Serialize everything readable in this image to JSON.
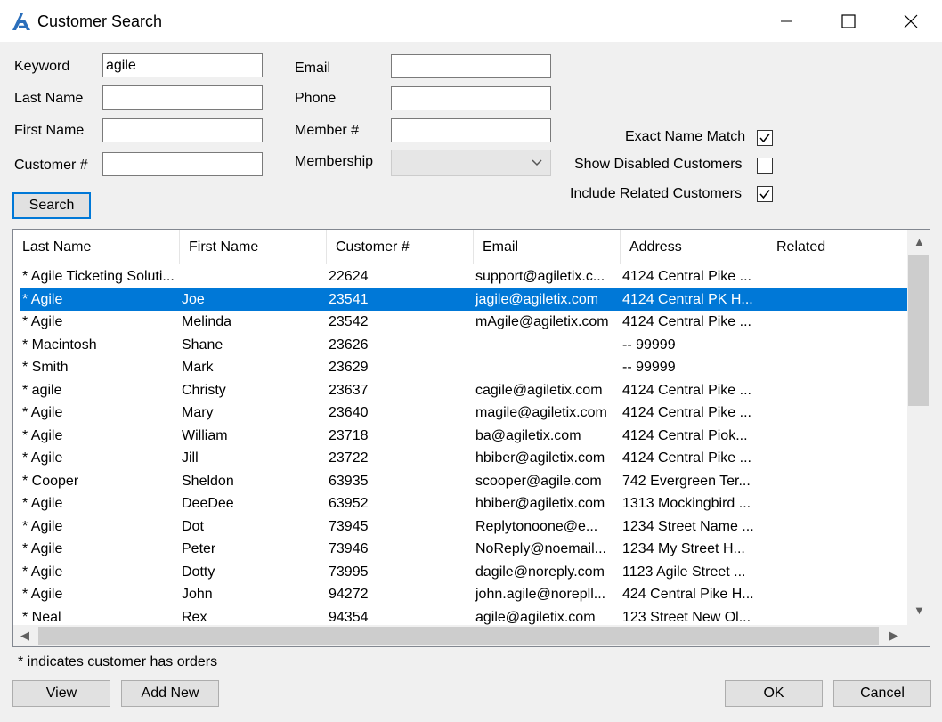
{
  "window": {
    "title": "Customer Search",
    "icon": "agile-logo-icon"
  },
  "form": {
    "keyword_label": "Keyword",
    "keyword_value": "agile",
    "lastname_label": "Last Name",
    "lastname_value": "",
    "firstname_label": "First Name",
    "firstname_value": "",
    "customer_label": "Customer #",
    "customer_value": "",
    "email_label": "Email",
    "email_value": "",
    "phone_label": "Phone",
    "phone_value": "",
    "member_label": "Member #",
    "member_value": "",
    "membership_label": "Membership",
    "membership_value": ""
  },
  "options": {
    "exact_label": "Exact Name Match",
    "exact_checked": true,
    "disabled_label": "Show Disabled Customers",
    "disabled_checked": false,
    "related_label": "Include Related Customers",
    "related_checked": true
  },
  "buttons": {
    "search": "Search",
    "view": "View",
    "add_new": "Add New",
    "ok": "OK",
    "cancel": "Cancel"
  },
  "table": {
    "columns": [
      "Last Name",
      "First Name",
      "Customer #",
      "Email",
      "Address",
      "Related"
    ],
    "selected_index": 1,
    "rows": [
      [
        "* Agile Ticketing Soluti...",
        "",
        "22624",
        "support@agiletix.c...",
        "4124 Central Pike ...",
        ""
      ],
      [
        "* Agile",
        "Joe",
        "23541",
        "jagile@agiletix.com",
        "4124 Central PK H...",
        ""
      ],
      [
        "* Agile",
        "Melinda",
        "23542",
        "mAgile@agiletix.com",
        "4124 Central Pike ...",
        ""
      ],
      [
        "* Macintosh",
        "Shane",
        "23626",
        "",
        "-- 99999",
        ""
      ],
      [
        "* Smith",
        "Mark",
        "23629",
        "",
        "-- 99999",
        ""
      ],
      [
        "* agile",
        "Christy",
        "23637",
        "cagile@agiletix.com",
        "4124 Central Pike ...",
        ""
      ],
      [
        "* Agile",
        "Mary",
        "23640",
        "magile@agiletix.com",
        "4124 Central Pike ...",
        ""
      ],
      [
        "* Agile",
        "William",
        "23718",
        "ba@agiletix.com",
        "4124 Central Piok...",
        ""
      ],
      [
        "* Agile",
        "Jill",
        "23722",
        "hbiber@agiletix.com",
        "4124 Central Pike ...",
        ""
      ],
      [
        "* Cooper",
        "Sheldon",
        "63935",
        "scooper@agile.com",
        "742 Evergreen Ter...",
        ""
      ],
      [
        "* Agile",
        "DeeDee",
        "63952",
        "hbiber@agiletix.com",
        "1313 Mockingbird ...",
        ""
      ],
      [
        "* Agile",
        "Dot",
        "73945",
        "Replytonoone@e...",
        "1234 Street Name ...",
        ""
      ],
      [
        "* Agile",
        "Peter",
        "73946",
        "NoReply@noemail...",
        "1234 My Street H...",
        ""
      ],
      [
        "* Agile",
        "Dotty",
        "73995",
        "dagile@noreply.com",
        "1123 Agile Street ...",
        ""
      ],
      [
        "* Agile",
        "John",
        "94272",
        "john.agile@norepll...",
        "424 Central Pike H...",
        ""
      ],
      [
        "* Neal",
        "Rex",
        "94354",
        "agile@agiletix.com",
        "123 Street New Ol...",
        ""
      ]
    ]
  },
  "footnote": "* indicates customer has orders"
}
